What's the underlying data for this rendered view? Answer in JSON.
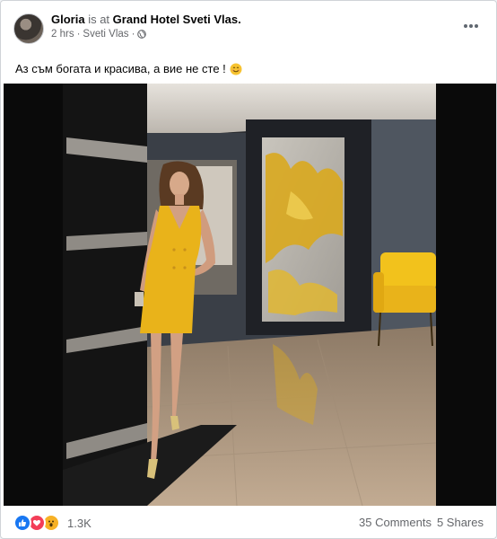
{
  "post": {
    "author": "Gloria",
    "connector": "is at",
    "location": "Grand Hotel Sveti Vlas.",
    "time": "2 hrs",
    "dot_separator": "·",
    "place": "Sveti Vlas",
    "dot_separator2": "·",
    "privacy_icon": "globe-icon",
    "text": "Аз съм богата и красива, а вие не сте !",
    "text_emoji": "smiling-face-icon",
    "more_icon": "more-options-icon"
  },
  "photo": {
    "description_icon": "photo",
    "colors": {
      "dress": "#e9b31a",
      "chair": "#f2c21c",
      "wall_art": "#d9a91e",
      "floor": "#b49a7e"
    }
  },
  "footer": {
    "reactions": [
      "like",
      "love",
      "wow"
    ],
    "reaction_count": "1.3K",
    "comments": "35 Comments",
    "shares": "5 Shares"
  },
  "colors": {
    "text_secondary": "#65676b",
    "like_blue": "#1877f2",
    "love_red": "#f33e58",
    "wow_yellow": "#f7b125"
  }
}
